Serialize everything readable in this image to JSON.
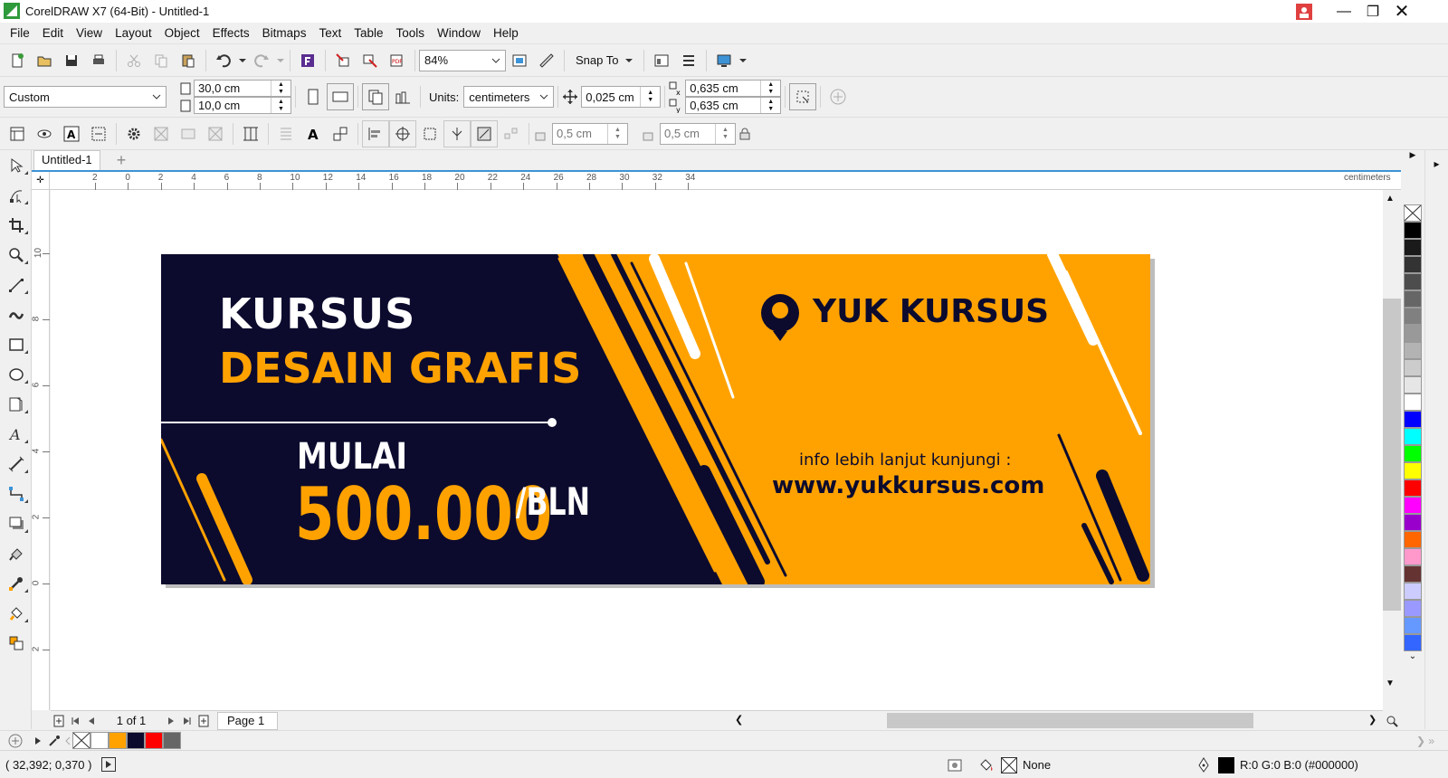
{
  "window": {
    "title": "CorelDRAW X7 (64-Bit) - Untitled-1"
  },
  "menu": [
    "File",
    "Edit",
    "View",
    "Layout",
    "Object",
    "Effects",
    "Bitmaps",
    "Text",
    "Table",
    "Tools",
    "Window",
    "Help"
  ],
  "toolbar": {
    "zoom": "84%",
    "snap_label": "Snap To"
  },
  "propbar": {
    "page_preset": "Custom",
    "width": "30,0 cm",
    "height": "10,0 cm",
    "units_label": "Units:",
    "units_value": "centimeters",
    "nudge": "0,025 cm",
    "dup_x": "0,635 cm",
    "dup_y": "0,635 cm"
  },
  "toolbar3": {
    "val1": "0,5 cm",
    "val2": "0,5 cm"
  },
  "doc_tab": "Untitled-1",
  "ruler": {
    "units": "centimeters",
    "h_ticks": [
      "2",
      "0",
      "2",
      "4",
      "6",
      "8",
      "10",
      "12",
      "14",
      "16",
      "18",
      "20",
      "22",
      "24",
      "26",
      "28",
      "30",
      "32",
      "34"
    ],
    "v_ticks": [
      "10",
      "8",
      "6",
      "4",
      "2",
      "0",
      "2"
    ]
  },
  "banner": {
    "line1": "KURSUS",
    "line2": "DESAIN GRAFIS",
    "mulai": "MULAI",
    "price": "500.000",
    "per": "/BLN",
    "brand": "YUK KURSUS",
    "info": "info lebih lanjut kunjungi :",
    "url": "www.yukkursus.com",
    "colors": {
      "navy": "#0c0b2e",
      "orange": "#ffa200",
      "white": "#ffffff"
    }
  },
  "pagenav": {
    "count": "1 of 1",
    "page_tab": "Page 1"
  },
  "status": {
    "coords": "( 32,392; 0,370 )",
    "fill_label": "None",
    "outline_label": "R:0 G:0 B:0 (#000000)"
  },
  "palette_colors": [
    "#000000",
    "#1a1a1a",
    "#333333",
    "#4d4d4d",
    "#666666",
    "#808080",
    "#999999",
    "#b3b3b3",
    "#cccccc",
    "#e6e6e6",
    "#ffffff",
    "#0000ff",
    "#00ffff",
    "#00ff00",
    "#ffff00",
    "#ff0000",
    "#ff00ff",
    "#9900cc",
    "#ff6600",
    "#ff99cc",
    "#663333",
    "#ccccff",
    "#9999ff",
    "#6699ff",
    "#3366ff"
  ],
  "doc_palette_colors": [
    "#ffffff",
    "#ffa200",
    "#0c0b2e",
    "#ff0000",
    "#666666"
  ]
}
